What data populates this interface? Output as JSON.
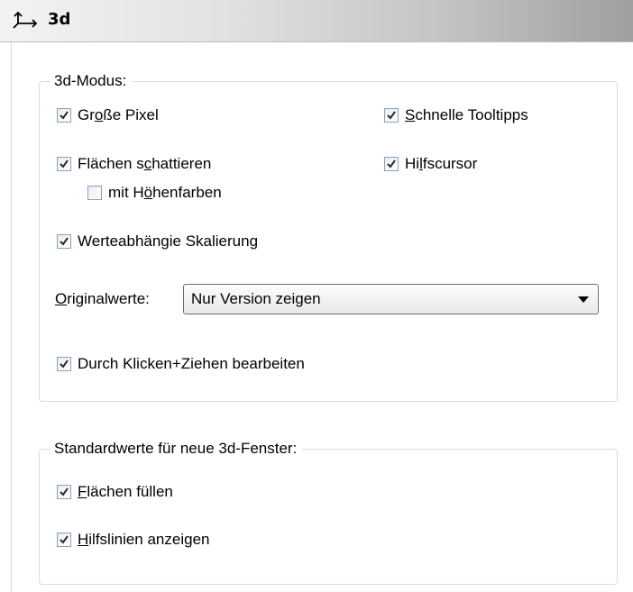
{
  "header": {
    "title": "3d",
    "icon": "3d-axes-icon"
  },
  "mode_group": {
    "legend": "3d-Modus:",
    "large_pixels": {
      "pre": "Gr",
      "mn": "o",
      "post": "ße Pixel",
      "checked": true
    },
    "fast_tooltips": {
      "pre": "",
      "mn": "S",
      "post": "chnelle Tooltipps",
      "checked": true
    },
    "shade_faces": {
      "pre": "Flächen s",
      "mn": "c",
      "post": "hattieren",
      "checked": true
    },
    "helper_cursor": {
      "pre": "Hi",
      "mn": "l",
      "post": "fscursor",
      "checked": true
    },
    "height_colors": {
      "pre": "mit H",
      "mn": "ö",
      "post": "henfarben",
      "checked": false
    },
    "value_scaling": {
      "pre": "Werteabhängie Skalierung",
      "mn": "",
      "post": "",
      "checked": true
    },
    "original_values": {
      "pre": "",
      "mn": "O",
      "post": "riginalwerte:",
      "selected": "Nur Version zeigen"
    },
    "click_drag_edit": {
      "pre": "Durch Klicken+Ziehen bearbeiten",
      "mn": "",
      "post": "",
      "checked": true
    }
  },
  "defaults_group": {
    "legend": "Standardwerte für neue 3d-Fenster:",
    "fill_faces": {
      "pre": "",
      "mn": "F",
      "post": "lächen füllen",
      "checked": true
    },
    "show_guides": {
      "pre": "",
      "mn": "H",
      "post": "ilfslinien anzeigen",
      "checked": true
    }
  }
}
